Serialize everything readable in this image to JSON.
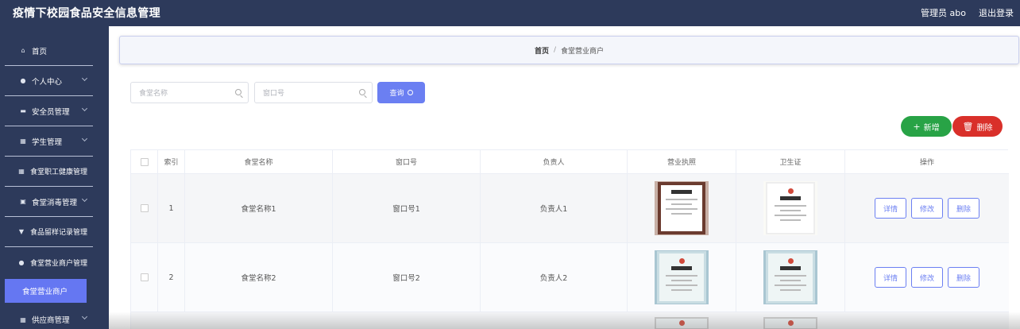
{
  "app": {
    "title": "疫情下校园食品安全信息管理",
    "user": "管理员 abo",
    "logout": "退出登录"
  },
  "sidebar": {
    "items": [
      {
        "label": "首页",
        "icon": "home-icon"
      },
      {
        "label": "个人中心",
        "icon": "user-icon"
      },
      {
        "label": "安全员管理",
        "icon": "device-icon"
      },
      {
        "label": "学生管理",
        "icon": "grid-icon"
      },
      {
        "label": "食堂职工健康管理",
        "icon": "grid-icon"
      },
      {
        "label": "食堂消毒管理",
        "icon": "lock-icon"
      },
      {
        "label": "食品留样记录管理",
        "icon": "filter-icon"
      },
      {
        "label": "食堂营业商户管理",
        "icon": "location-icon"
      },
      {
        "label": "供应商管理",
        "icon": "grid-icon"
      }
    ],
    "active_sub": "食堂营业商户"
  },
  "breadcrumb": {
    "home": "首页",
    "sep": "/",
    "current": "食堂营业商户"
  },
  "search": {
    "name_placeholder": "食堂名称",
    "window_placeholder": "窗口号",
    "query_label": "查询"
  },
  "actions": {
    "add_label": "新增",
    "delete_label": "删除"
  },
  "table": {
    "headers": [
      "索引",
      "食堂名称",
      "窗口号",
      "负责人",
      "营业执照",
      "卫生证",
      "操作"
    ],
    "rows": [
      {
        "index": "1",
        "name": "食堂名称1",
        "window": "窗口号1",
        "manager": "负责人1"
      },
      {
        "index": "2",
        "name": "食堂名称2",
        "window": "窗口号2",
        "manager": "负责人2"
      }
    ],
    "op_buttons": {
      "detail": "详情",
      "edit": "修改",
      "delete": "删除"
    }
  }
}
